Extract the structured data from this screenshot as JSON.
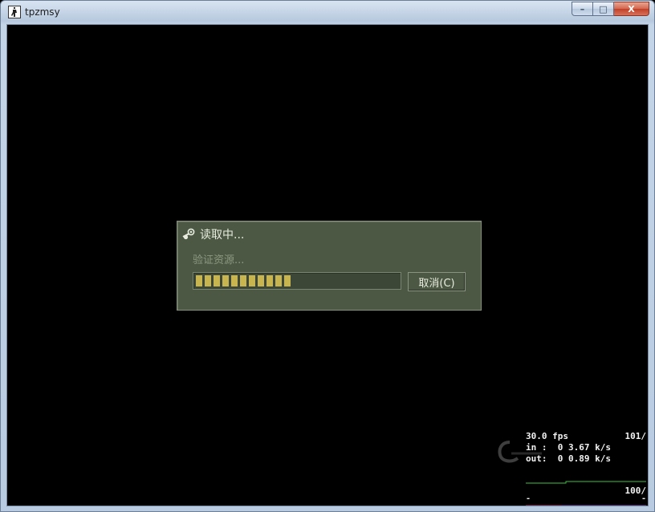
{
  "window": {
    "title": "tpzmsy",
    "controls": {
      "minimize": "–",
      "maximize": "□",
      "close": "X"
    }
  },
  "dialog": {
    "title": "读取中...",
    "status": "验证资源...",
    "progress": 0.47,
    "progress_segments": 11,
    "cancel_label": "取消(C)",
    "colors": {
      "background": "#4c5844",
      "progress_fill": "#c8b54f",
      "title_text": "#e8ecdf",
      "status_text": "#8c9880"
    }
  },
  "netgraph": {
    "fps": "30.0 fps",
    "fps_right": "101/",
    "in": "in :  0 3.67 k/s",
    "out": "out:  0 0.89 k/s",
    "bottom_right": "100/",
    "dash_left": "-",
    "dash_right": "-"
  }
}
